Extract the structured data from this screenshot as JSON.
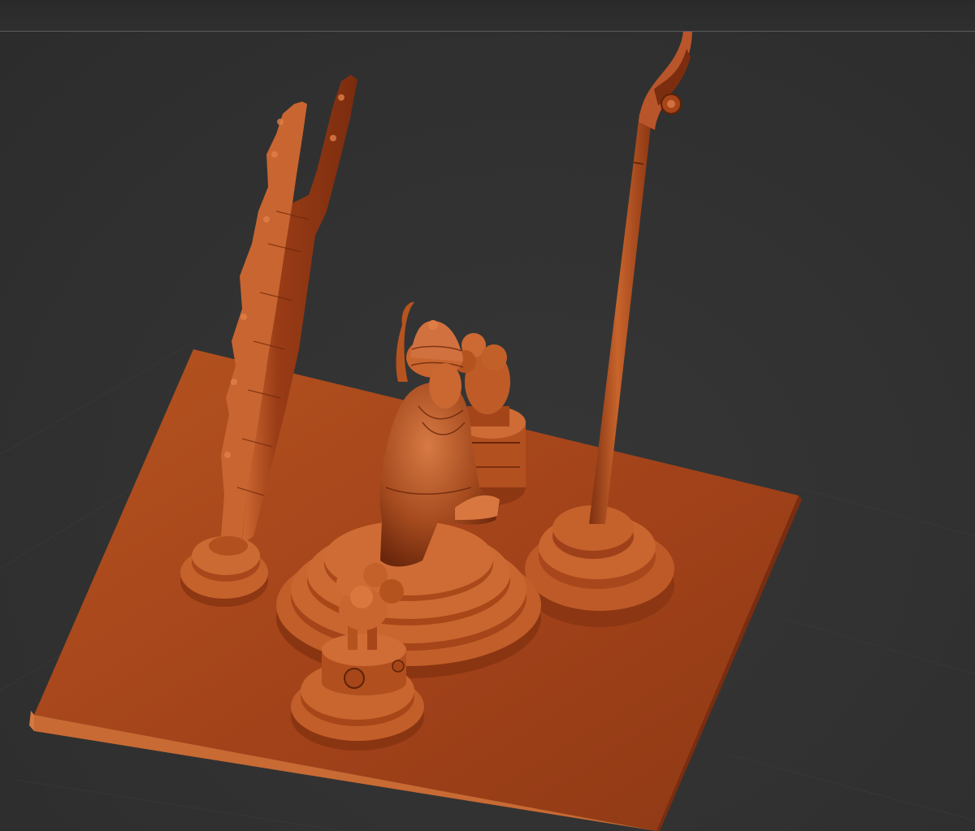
{
  "app": {
    "type": "3d-sculpt-viewport",
    "model_color": "#a8451c",
    "model_highlight": "#d9703c",
    "model_shadow": "#5e2208",
    "background_color": "#313131",
    "grid_color": "#3a3a3a"
  },
  "viewport": {
    "objects": [
      "base-platform",
      "carved-panel",
      "seated-figure",
      "stepped-dais",
      "lion-pillar-back",
      "lion-pillar-front",
      "flag-pole",
      "pole-base"
    ]
  }
}
